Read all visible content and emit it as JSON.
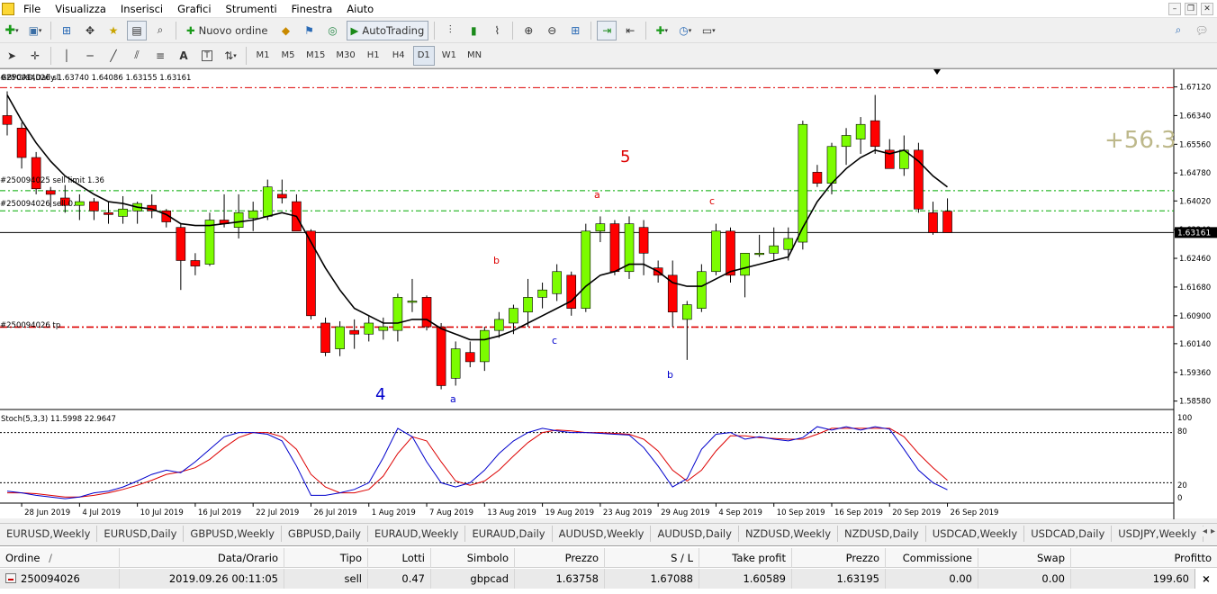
{
  "menu": {
    "items": [
      "File",
      "Visualizza",
      "Inserisci",
      "Grafici",
      "Strumenti",
      "Finestra",
      "Aiuto"
    ],
    "window_controls": [
      "–",
      "❐",
      "✕"
    ]
  },
  "toolbar": {
    "new_order_label": "Nuovo ordine",
    "autotrading_label": "AutoTrading"
  },
  "timeframes": [
    "M1",
    "M5",
    "M15",
    "M30",
    "H1",
    "H4",
    "D1",
    "W1",
    "MN"
  ],
  "active_timeframe": "D1",
  "chart": {
    "header_info": "GBPCAD,Daily  1.63740 1.64086 1.63155 1.63161",
    "order_labels": {
      "sl": "#250094026 sl",
      "sell_limit": "#250094025 sell limit 1.36",
      "sell": "#250094026 sell 0.",
      "tp": "#250094026 tp"
    },
    "current_price_label": "1.63161",
    "profit_pips": "+56.3",
    "annotations": {
      "wave_4": "4",
      "wave_5": "5",
      "a_blue_1": "a",
      "b_red_1": "b",
      "c_blue_1": "c",
      "a_red_2": "a",
      "b_blue_2": "b",
      "c_red_2": "c"
    },
    "stoch_label": "Stoch(5,3,3) 11.5998 22.9647",
    "stoch_levels": [
      "100",
      "80",
      "20",
      "0"
    ],
    "price_ticks": [
      "1.67120",
      "1.66340",
      "1.65560",
      "1.64780",
      "1.64020",
      "1.63240",
      "1.62460",
      "1.61680",
      "1.60900",
      "1.60140",
      "1.59360",
      "1.58580"
    ],
    "date_ticks": [
      "28 Jun 2019",
      "4 Jul 2019",
      "10 Jul 2019",
      "16 Jul 2019",
      "22 Jul 2019",
      "26 Jul 2019",
      "1 Aug 2019",
      "7 Aug 2019",
      "13 Aug 2019",
      "19 Aug 2019",
      "23 Aug 2019",
      "29 Aug 2019",
      "4 Sep 2019",
      "10 Sep 2019",
      "16 Sep 2019",
      "20 Sep 2019",
      "26 Sep 2019"
    ],
    "colors": {
      "bull": "#7cfc00",
      "bear": "#ff0000",
      "ma": "#000000",
      "sl_tp_line": "#dd0000",
      "order_line": "#00aa00",
      "stoch_main": "#0000cc",
      "stoch_signal": "#dd0000"
    }
  },
  "chart_data": {
    "type": "candlestick",
    "symbol": "GBPCAD",
    "timeframe": "Daily",
    "dates": [
      "27 Jun",
      "28 Jun",
      "1 Jul",
      "2 Jul",
      "3 Jul",
      "4 Jul",
      "5 Jul",
      "8 Jul",
      "9 Jul",
      "10 Jul",
      "11 Jul",
      "12 Jul",
      "15 Jul",
      "16 Jul",
      "17 Jul",
      "18 Jul",
      "19 Jul",
      "22 Jul",
      "23 Jul",
      "24 Jul",
      "25 Jul",
      "26 Jul",
      "29 Jul",
      "30 Jul",
      "31 Jul",
      "1 Aug",
      "2 Aug",
      "5 Aug",
      "6 Aug",
      "7 Aug",
      "8 Aug",
      "9 Aug",
      "12 Aug",
      "13 Aug",
      "14 Aug",
      "15 Aug",
      "16 Aug",
      "19 Aug",
      "20 Aug",
      "21 Aug",
      "22 Aug",
      "23 Aug",
      "26 Aug",
      "27 Aug",
      "28 Aug",
      "29 Aug",
      "30 Aug",
      "2 Sep",
      "3 Sep",
      "4 Sep",
      "5 Sep",
      "6 Sep",
      "9 Sep",
      "10 Sep",
      "11 Sep",
      "12 Sep",
      "13 Sep",
      "16 Sep",
      "17 Sep",
      "18 Sep",
      "19 Sep",
      "20 Sep",
      "23 Sep",
      "24 Sep",
      "25 Sep",
      "26 Sep"
    ],
    "ohlc": [
      [
        1.6634,
        1.67,
        1.658,
        1.661
      ],
      [
        1.66,
        1.6615,
        1.649,
        1.652
      ],
      [
        1.652,
        1.6535,
        1.642,
        1.6435
      ],
      [
        1.643,
        1.644,
        1.6385,
        1.642
      ],
      [
        1.641,
        1.6445,
        1.637,
        1.639
      ],
      [
        1.639,
        1.642,
        1.635,
        1.64
      ],
      [
        1.64,
        1.641,
        1.635,
        1.6375
      ],
      [
        1.637,
        1.64,
        1.634,
        1.6365
      ],
      [
        1.636,
        1.6415,
        1.634,
        1.638
      ],
      [
        1.6375,
        1.64,
        1.634,
        1.6395
      ],
      [
        1.639,
        1.642,
        1.6355,
        1.6375
      ],
      [
        1.6375,
        1.638,
        1.633,
        1.6345
      ],
      [
        1.633,
        1.634,
        1.616,
        1.624
      ],
      [
        1.624,
        1.626,
        1.62,
        1.6225
      ],
      [
        1.623,
        1.637,
        1.6225,
        1.635
      ],
      [
        1.635,
        1.642,
        1.633,
        1.634
      ],
      [
        1.633,
        1.642,
        1.63,
        1.637
      ],
      [
        1.6355,
        1.64,
        1.632,
        1.6375
      ],
      [
        1.636,
        1.646,
        1.635,
        1.644
      ],
      [
        1.642,
        1.646,
        1.6395,
        1.641
      ],
      [
        1.64,
        1.642,
        1.632,
        1.632
      ],
      [
        1.632,
        1.6325,
        1.608,
        1.609
      ],
      [
        1.607,
        1.6085,
        1.598,
        1.599
      ],
      [
        1.6,
        1.6075,
        1.598,
        1.606
      ],
      [
        1.605,
        1.608,
        1.6,
        1.604
      ],
      [
        1.604,
        1.609,
        1.602,
        1.607
      ],
      [
        1.605,
        1.6085,
        1.6025,
        1.606
      ],
      [
        1.605,
        1.615,
        1.602,
        1.614
      ],
      [
        1.613,
        1.619,
        1.61,
        1.613
      ],
      [
        1.614,
        1.6145,
        1.605,
        1.606
      ],
      [
        1.606,
        1.607,
        1.589,
        1.59
      ],
      [
        1.592,
        1.602,
        1.59,
        1.6
      ],
      [
        1.599,
        1.602,
        1.595,
        1.5965
      ],
      [
        1.5965,
        1.606,
        1.594,
        1.605
      ],
      [
        1.605,
        1.61,
        1.603,
        1.608
      ],
      [
        1.607,
        1.612,
        1.604,
        1.611
      ],
      [
        1.61,
        1.619,
        1.606,
        1.614
      ],
      [
        1.614,
        1.618,
        1.611,
        1.616
      ],
      [
        1.615,
        1.623,
        1.613,
        1.621
      ],
      [
        1.62,
        1.621,
        1.609,
        1.611
      ],
      [
        1.611,
        1.634,
        1.61,
        1.632
      ],
      [
        1.632,
        1.636,
        1.629,
        1.634
      ],
      [
        1.634,
        1.635,
        1.62,
        1.621
      ],
      [
        1.621,
        1.636,
        1.619,
        1.634
      ],
      [
        1.633,
        1.635,
        1.62,
        1.626
      ],
      [
        1.622,
        1.624,
        1.618,
        1.62
      ],
      [
        1.62,
        1.624,
        1.606,
        1.61
      ],
      [
        1.608,
        1.613,
        1.597,
        1.612
      ],
      [
        1.611,
        1.623,
        1.61,
        1.621
      ],
      [
        1.621,
        1.634,
        1.62,
        1.632
      ],
      [
        1.632,
        1.633,
        1.618,
        1.62
      ],
      [
        1.62,
        1.626,
        1.614,
        1.626
      ],
      [
        1.626,
        1.631,
        1.625,
        1.626
      ],
      [
        1.626,
        1.633,
        1.624,
        1.628
      ],
      [
        1.627,
        1.633,
        1.624,
        1.63
      ],
      [
        1.629,
        1.662,
        1.627,
        1.661
      ],
      [
        1.648,
        1.65,
        1.644,
        1.645
      ],
      [
        1.645,
        1.656,
        1.642,
        1.655
      ],
      [
        1.655,
        1.66,
        1.65,
        1.658
      ],
      [
        1.657,
        1.663,
        1.653,
        1.661
      ],
      [
        1.662,
        1.669,
        1.653,
        1.655
      ],
      [
        1.654,
        1.657,
        1.649,
        1.649
      ],
      [
        1.649,
        1.658,
        1.647,
        1.654
      ],
      [
        1.654,
        1.656,
        1.637,
        1.638
      ],
      [
        1.637,
        1.64,
        1.631,
        1.6316
      ],
      [
        1.6374,
        1.6409,
        1.6316,
        1.6316
      ]
    ],
    "ma": [
      1.669,
      1.662,
      1.656,
      1.651,
      1.647,
      1.6445,
      1.642,
      1.64,
      1.6395,
      1.6385,
      1.638,
      1.6365,
      1.634,
      1.6335,
      1.6335,
      1.634,
      1.6345,
      1.635,
      1.636,
      1.637,
      1.636,
      1.629,
      1.622,
      1.616,
      1.611,
      1.609,
      1.607,
      1.607,
      1.608,
      1.608,
      1.6055,
      1.604,
      1.6025,
      1.6025,
      1.6035,
      1.605,
      1.607,
      1.609,
      1.611,
      1.613,
      1.617,
      1.62,
      1.621,
      1.623,
      1.623,
      1.621,
      1.618,
      1.617,
      1.617,
      1.619,
      1.621,
      1.622,
      1.623,
      1.624,
      1.625,
      1.633,
      1.64,
      1.645,
      1.649,
      1.652,
      1.654,
      1.653,
      1.654,
      1.651,
      1.647,
      1.644
    ],
    "levels": {
      "sl": 1.671,
      "sell_limit": 1.643,
      "sell": 1.6375,
      "current": 1.63161,
      "tp": 1.6059
    },
    "ylim": [
      1.584,
      1.675
    ],
    "stochastic": {
      "params": "5,3,3",
      "main": [
        10,
        8,
        5,
        3,
        1,
        3,
        8,
        10,
        15,
        22,
        30,
        35,
        32,
        45,
        60,
        75,
        80,
        80,
        78,
        70,
        40,
        5,
        5,
        8,
        12,
        20,
        50,
        85,
        75,
        45,
        20,
        15,
        20,
        35,
        55,
        70,
        80,
        85,
        82,
        80,
        80,
        79,
        78,
        77,
        62,
        40,
        15,
        25,
        60,
        78,
        80,
        72,
        75,
        72,
        70,
        74,
        87,
        83,
        87,
        83,
        87,
        84,
        60,
        35,
        20,
        11.6
      ],
      "signal": [
        8,
        8,
        7,
        5,
        3,
        3,
        5,
        8,
        12,
        17,
        23,
        30,
        33,
        38,
        48,
        62,
        74,
        80,
        80,
        75,
        60,
        30,
        15,
        8,
        8,
        12,
        28,
        55,
        75,
        70,
        45,
        22,
        17,
        22,
        35,
        52,
        68,
        80,
        83,
        82,
        80,
        80,
        79,
        78,
        72,
        58,
        35,
        22,
        35,
        58,
        76,
        76,
        74,
        73,
        72,
        72,
        78,
        85,
        85,
        85,
        85,
        85,
        75,
        55,
        38,
        22.96
      ]
    }
  },
  "symbol_tabs": [
    "EURUSD,Weekly",
    "EURUSD,Daily",
    "GBPUSD,Weekly",
    "GBPUSD,Daily",
    "EURAUD,Weekly",
    "EURAUD,Daily",
    "AUDUSD,Weekly",
    "AUDUSD,Daily",
    "NZDUSD,Weekly",
    "NZDUSD,Daily",
    "USDCAD,Weekly",
    "USDCAD,Daily",
    "USDJPY,Weekly"
  ],
  "tab_arrows": [
    "◂",
    "▸"
  ],
  "trade_table": {
    "headers": {
      "ordine": "Ordine",
      "sort_arrow": "/",
      "data": "Data/Orario",
      "tipo": "Tipo",
      "lotti": "Lotti",
      "simbolo": "Simbolo",
      "prezzo": "Prezzo",
      "sl": "S / L",
      "tp": "Take profit",
      "prezzo2": "Prezzo",
      "commissione": "Commissione",
      "swap": "Swap",
      "profitto": "Profitto"
    },
    "row": {
      "order": "250094026",
      "time": "2019.09.26 00:11:05",
      "type": "sell",
      "lots": "0.47",
      "symbol": "gbpcad",
      "price": "1.63758",
      "sl": "1.67088",
      "tp": "1.60589",
      "current": "1.63195",
      "commission": "0.00",
      "swap": "0.00",
      "profit": "199.60",
      "close": "×"
    }
  }
}
